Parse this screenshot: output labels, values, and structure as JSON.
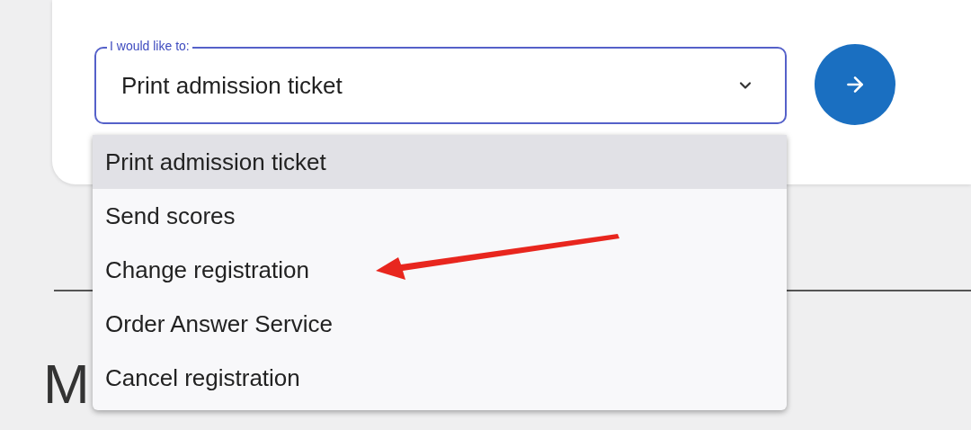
{
  "field": {
    "label": "I would like to:",
    "value": "Print admission ticket",
    "expanded": true
  },
  "menu": {
    "options": [
      {
        "label": "Print admission ticket",
        "selected": true
      },
      {
        "label": "Send scores",
        "selected": false
      },
      {
        "label": "Change registration",
        "selected": false
      },
      {
        "label": "Order Answer Service",
        "selected": false
      },
      {
        "label": "Cancel registration",
        "selected": false
      }
    ]
  },
  "heading": {
    "text": "M"
  }
}
